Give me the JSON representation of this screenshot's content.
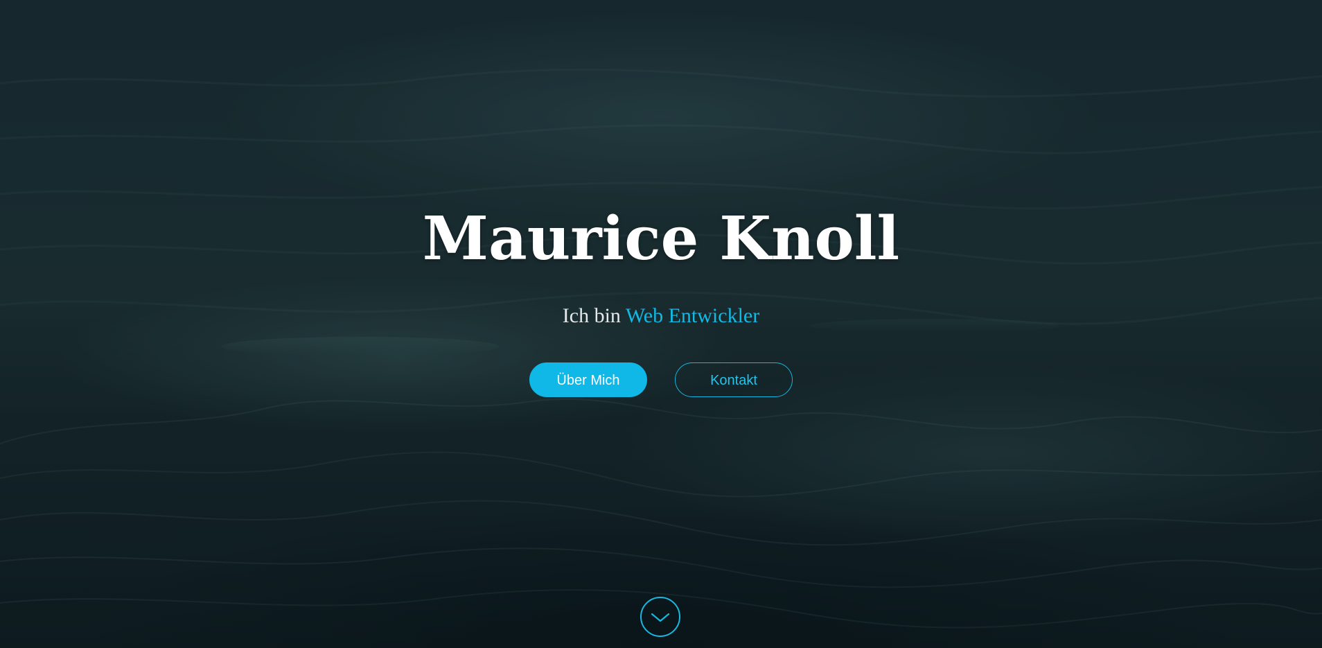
{
  "hero": {
    "name": "Maurice Knoll",
    "tagline_prefix": "Ich bin",
    "tagline_role": "Web Entwickler",
    "buttons": {
      "about": "Über Mich",
      "contact": "Kontakt"
    },
    "scroll_icon": "chevron-down-icon"
  },
  "colors": {
    "accent": "#0fb8e6",
    "text": "#ffffff",
    "background": "#1b3036"
  }
}
